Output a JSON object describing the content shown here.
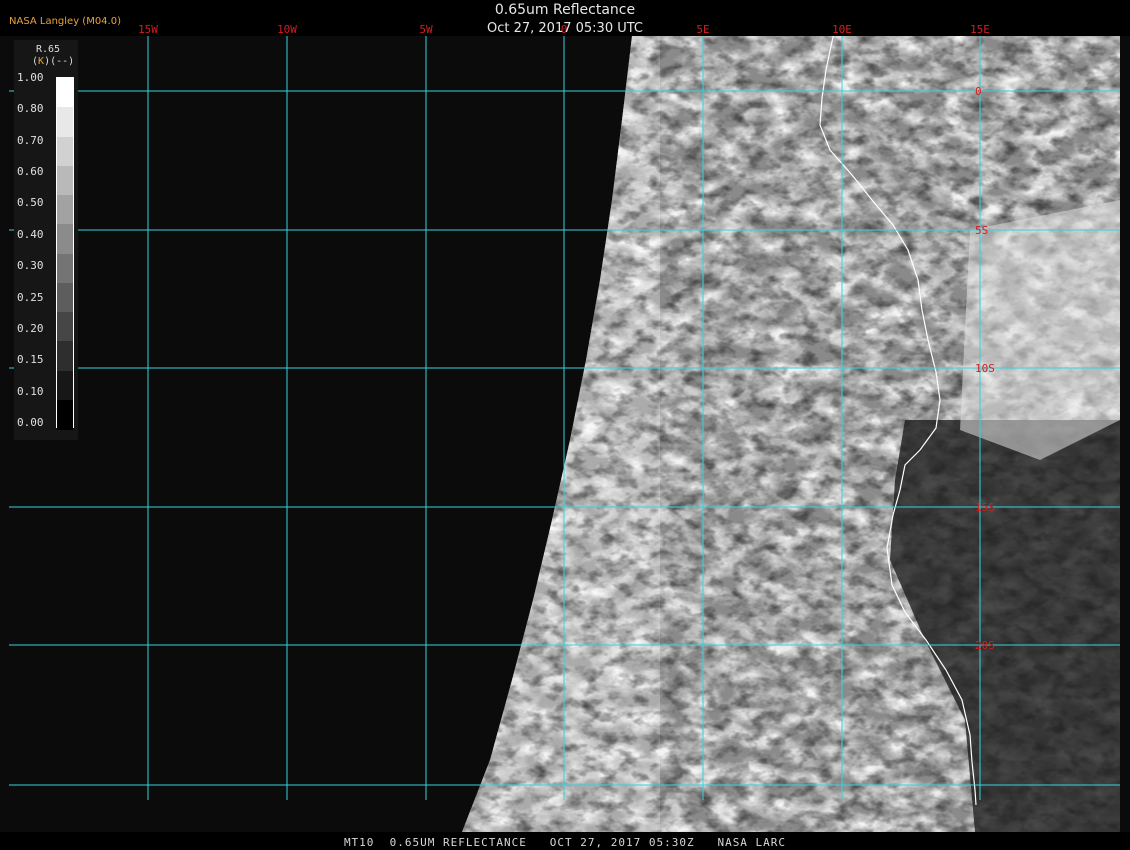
{
  "header": {
    "credit": "NASA Langley (M04.0)",
    "title": "0.65um Reflectance",
    "subtitle": "Oct 27, 2017 05:30 UTC"
  },
  "footer": {
    "caption": "MT10  0.65UM REFLECTANCE   OCT 27, 2017 05:30Z   NASA LARC"
  },
  "legend": {
    "variable": "R.65",
    "unit_prefix": "(",
    "unit_mark": "K",
    "unit_rest": ")(--)",
    "ticks": [
      "1.00",
      "0.80",
      "0.70",
      "0.60",
      "0.50",
      "0.40",
      "0.30",
      "0.25",
      "0.20",
      "0.15",
      "0.10",
      "0.00"
    ]
  },
  "grid": {
    "line_color": "#35d3de",
    "label_color": "#d21f1f",
    "lon_labels": [
      "15W",
      "10W",
      "5W",
      "0",
      "5E",
      "10E",
      "15E"
    ],
    "lat_labels": [
      "0",
      "5S",
      "10S",
      "15S",
      "20S"
    ]
  },
  "colors": {
    "space": "#0b0b0b",
    "coastline": "#ffffff"
  }
}
